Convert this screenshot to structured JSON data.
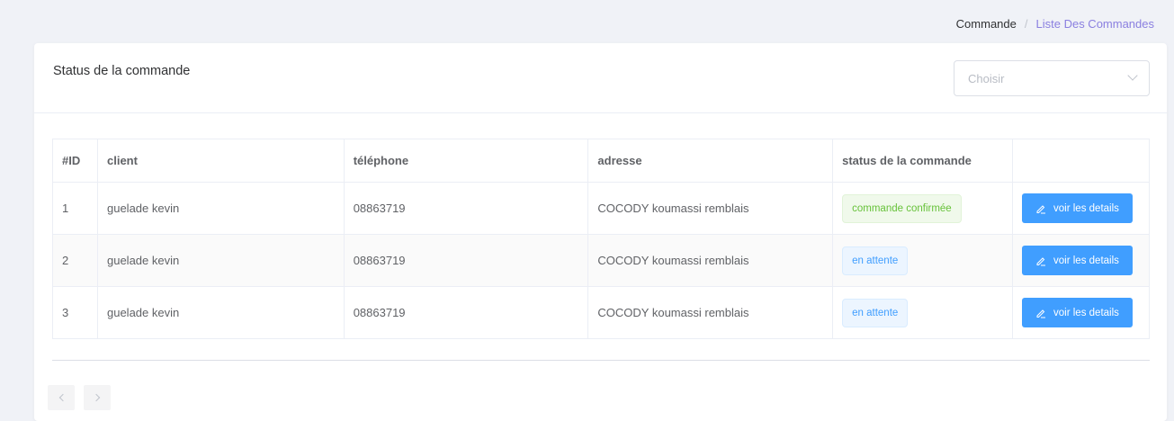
{
  "breadcrumb": {
    "items": [
      "Commande",
      "Liste Des Commandes"
    ],
    "separator": "/"
  },
  "card": {
    "title": "Status de la commande",
    "select": {
      "placeholder": "Choisir",
      "icon": "chevron-down-icon"
    }
  },
  "table": {
    "headers": [
      "#ID",
      "client",
      "téléphone",
      "adresse",
      "status de la commande",
      ""
    ],
    "rows": [
      {
        "id": "1",
        "client": "guelade kevin",
        "phone": "08863719",
        "address": "COCODY koumassi remblais",
        "status": "commande confirmée",
        "status_type": "success",
        "action": "voir les details"
      },
      {
        "id": "2",
        "client": "guelade kevin",
        "phone": "08863719",
        "address": "COCODY koumassi remblais",
        "status": "en attente",
        "status_type": "info",
        "action": "voir les details"
      },
      {
        "id": "3",
        "client": "guelade kevin",
        "phone": "08863719",
        "address": "COCODY koumassi remblais",
        "status": "en attente",
        "status_type": "info",
        "action": "voir les details"
      }
    ]
  },
  "pagination": {
    "prev_icon": "chevron-left-icon",
    "next_icon": "chevron-right-icon"
  },
  "colors": {
    "primary": "#409eff",
    "success": "#67c23a",
    "breadcrumb_active": "#8a7fe0",
    "background": "#f0f2f7"
  }
}
